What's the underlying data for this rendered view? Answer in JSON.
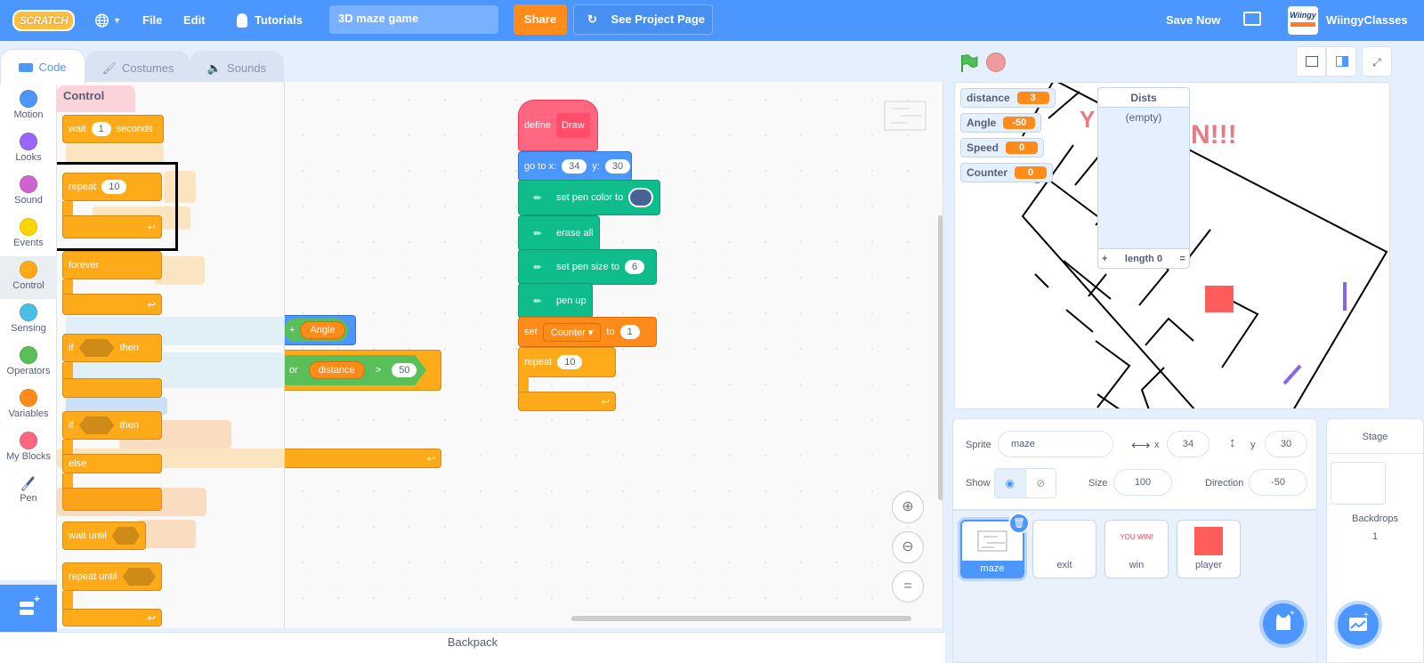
{
  "menubar": {
    "logo": "SCRATCH",
    "file": "File",
    "edit": "Edit",
    "tutorials": "Tutorials",
    "project_title": "3D maze game",
    "share": "Share",
    "see_project_page": "See Project Page",
    "save_now": "Save Now",
    "username": "WiingyClasses",
    "avatar_text": "Wiingy"
  },
  "tabs": [
    {
      "label": "Code"
    },
    {
      "label": "Costumes"
    },
    {
      "label": "Sounds"
    }
  ],
  "categories": [
    {
      "label": "Motion",
      "color": "#4c97ff"
    },
    {
      "label": "Looks",
      "color": "#9966ff"
    },
    {
      "label": "Sound",
      "color": "#cf63cf"
    },
    {
      "label": "Events",
      "color": "#ffd500"
    },
    {
      "label": "Control",
      "color": "#ffab19"
    },
    {
      "label": "Sensing",
      "color": "#4cbfe6"
    },
    {
      "label": "Operators",
      "color": "#59c059"
    },
    {
      "label": "Variables",
      "color": "#ff8c1a"
    },
    {
      "label": "My Blocks",
      "color": "#ff6680"
    },
    {
      "label": "Pen",
      "color": ""
    }
  ],
  "palette": {
    "heading": "Control",
    "wait": {
      "label": "wait",
      "value": "1",
      "suffix": "seconds"
    },
    "repeat": {
      "label": "repeat",
      "value": "10"
    },
    "forever": {
      "label": "forever"
    },
    "if_then": {
      "if": "if",
      "then": "then"
    },
    "if_else": {
      "if": "if",
      "then": "then",
      "else": "else"
    },
    "wait_until": {
      "label": "wait until"
    },
    "repeat_until": {
      "label": "repeat until"
    }
  },
  "workspace": {
    "angle_expr": {
      "plus": "+",
      "var": "Angle"
    },
    "or_expr": {
      "or": "or",
      "var": "distance",
      "op": ">",
      "value": "50"
    },
    "script": {
      "define": "define",
      "define_name": "Draw",
      "goto_label": "go to x:",
      "goto_x": "34",
      "goto_y_label": "y:",
      "goto_y": "30",
      "pen_color": "set pen color to",
      "pen_color_value": "#4a6194",
      "erase_all": "erase all",
      "pen_size": "set pen size to",
      "pen_size_value": "6",
      "pen_up": "pen up",
      "set": "set",
      "set_var": "Counter",
      "set_to": "to",
      "set_value": "1",
      "repeat": "repeat",
      "repeat_value": "10"
    }
  },
  "stage": {
    "monitors": [
      {
        "name": "distance",
        "value": "3"
      },
      {
        "name": "Angle",
        "value": "-50"
      },
      {
        "name": "Speed",
        "value": "0"
      },
      {
        "name": "Counter",
        "value": "0"
      }
    ],
    "list": {
      "name": "Dists",
      "empty": "(empty)",
      "add": "+",
      "length": "length 0",
      "resize": "="
    }
  },
  "sprite_info": {
    "sprite_label": "Sprite",
    "sprite_name": "maze",
    "x_label": "x",
    "x": "34",
    "y_label": "y",
    "y": "30",
    "show_label": "Show",
    "size_label": "Size",
    "size": "100",
    "direction_label": "Direction",
    "direction": "-50"
  },
  "sprites": [
    {
      "name": "maze",
      "selected": true
    },
    {
      "name": "exit"
    },
    {
      "name": "win",
      "thumb_text": "YOU WIN!"
    },
    {
      "name": "player"
    }
  ],
  "stage_panel": {
    "title": "Stage",
    "backdrops_label": "Backdrops",
    "backdrops_count": "1"
  },
  "backpack": "Backpack"
}
